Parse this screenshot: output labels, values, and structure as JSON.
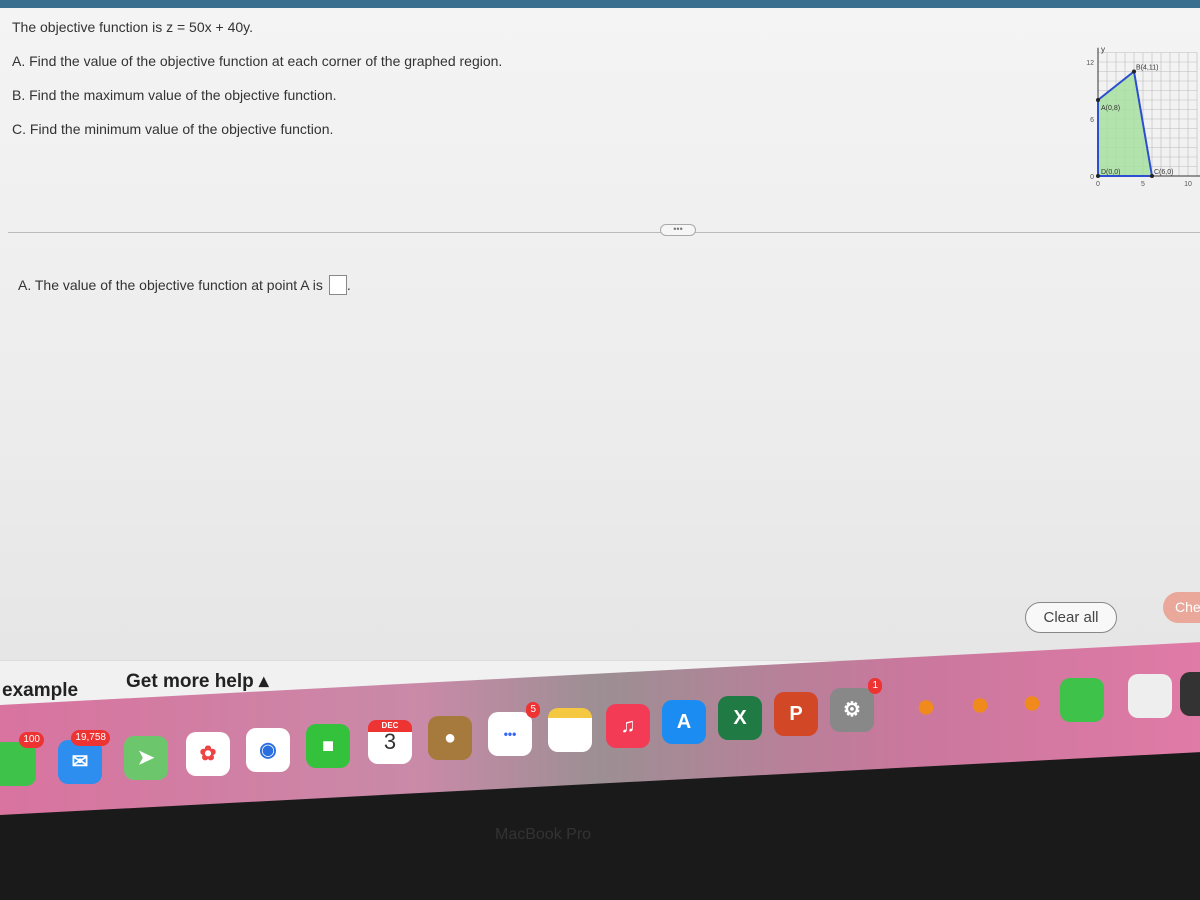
{
  "question": {
    "intro": "The objective function is z = 50x + 40y.",
    "part_a": "A. Find the value of the objective function at each corner of the graphed region.",
    "part_b": "B. Find the maximum value of the objective function.",
    "part_c": "C. Find the minimum value of the objective function."
  },
  "graph": {
    "axis_y_label": "y",
    "y_ticks": [
      "12",
      "6",
      "0"
    ],
    "x_ticks": [
      "0",
      "5",
      "10"
    ],
    "points": [
      {
        "label": "A(0,8)",
        "x": 0,
        "y": 8
      },
      {
        "label": "B(4,11)",
        "x": 4,
        "y": 11
      },
      {
        "label": "C(6,0)",
        "x": 6,
        "y": 0
      },
      {
        "label": "D(0,0)",
        "x": 0,
        "y": 0
      }
    ],
    "fill_color": "#a8e0a0",
    "edge_color": "#2b4fd0"
  },
  "more_button": "•••",
  "answer": {
    "prompt": "A. The value of the objective function at point A is",
    "value": ""
  },
  "buttons": {
    "clear_all": "Clear all",
    "check": "Che"
  },
  "footer": {
    "example": "example",
    "get_more_help": "Get more help ▴"
  },
  "dock": {
    "messages_badge": "100",
    "mail_badge": "19,758",
    "calendar_month": "DEC",
    "calendar_day": "3",
    "reminders_badge": "5",
    "settings_badge": "1"
  },
  "laptop_label": "MacBook Pro"
}
